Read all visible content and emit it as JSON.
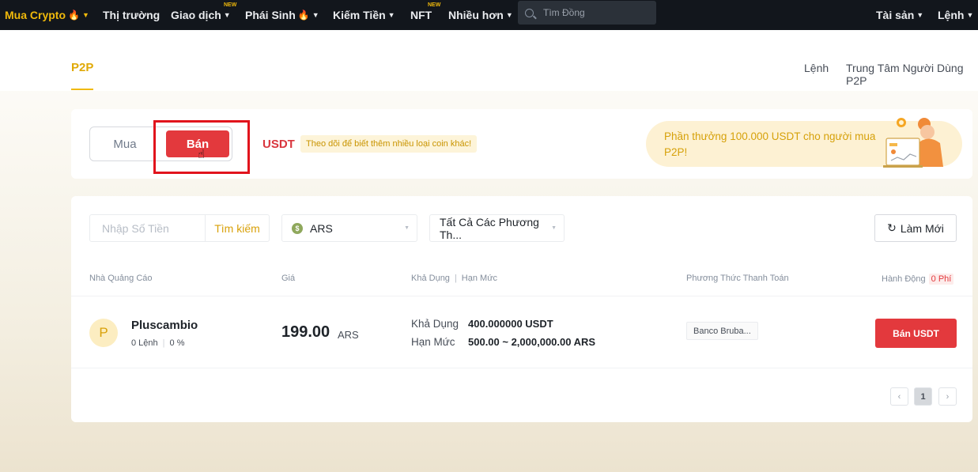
{
  "nav": {
    "buy_crypto": "Mua Crypto",
    "markets": "Thị trường",
    "trade": "Giao dịch",
    "derivatives": "Phái Sinh",
    "earn": "Kiếm Tiền",
    "nft": "NFT",
    "more": "Nhiều hơn",
    "new_badge": "NEW",
    "search_placeholder": "Tìm Đồng",
    "assets": "Tài sản",
    "orders": "Lệnh"
  },
  "p2p_header": {
    "tab": "P2P",
    "orders_link": "Lệnh",
    "user_center_link": "Trung Tâm Người Dùng P2P"
  },
  "trade_toggle": {
    "buy": "Mua",
    "sell": "Bán",
    "coin": "USDT",
    "coin_hint": "Theo dõi để biết thêm nhiều loại coin khác!"
  },
  "promo": {
    "text": "Phần thưởng 100.000 USDT cho người mua P2P!"
  },
  "filters": {
    "amount_placeholder": "Nhập Số Tiền",
    "amount_search": "Tìm kiếm",
    "fiat": "ARS",
    "fiat_icon_glyph": "$",
    "payment_method": "Tất Cả Các Phương Th...",
    "refresh": "Làm Mới"
  },
  "table": {
    "columns": {
      "advertiser": "Nhà Quảng Cáo",
      "price": "Giá",
      "available": "Khả Dụng",
      "limit": "Hạn Mức",
      "payment": "Phương Thức Thanh Toán",
      "action": "Hành Động",
      "fee": "0 Phí"
    },
    "rows": [
      {
        "avatar_letter": "P",
        "name": "Pluscambio",
        "orders": "0 Lệnh",
        "completion": "0 %",
        "price": "199.00",
        "currency": "ARS",
        "available_label": "Khả Dụng",
        "available_value": "400.000000 USDT",
        "limit_label": "Hạn Mức",
        "limit_value": "500.00 ~ 2,000,000.00 ARS",
        "payment": "Banco Bruba...",
        "action": "Bán USDT"
      }
    ]
  },
  "pagination": {
    "prev": "‹",
    "current": "1",
    "next": "›"
  },
  "colors": {
    "brand_yellow": "#f0b90b",
    "sell_red": "#e3393d",
    "highlight_red": "#e1141c",
    "nav_bg": "#12161c"
  }
}
